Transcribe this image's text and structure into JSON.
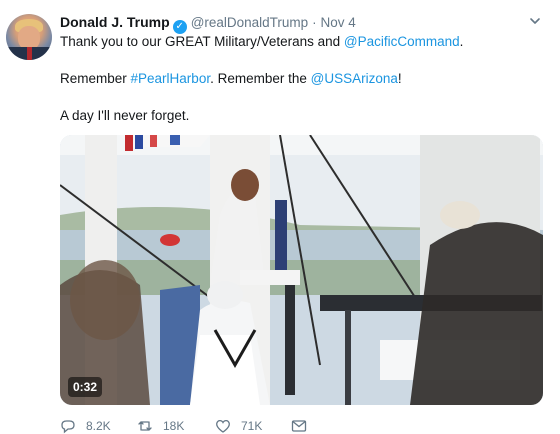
{
  "tweet": {
    "author_name": "Donald J. Trump",
    "handle": "@realDonaldTrump",
    "separator": "·",
    "time": "Nov 4",
    "line1_prefix": "Thank you to our GREAT Military/Veterans and ",
    "line1_link": "@PacificCommand",
    "line1_suffix": ".",
    "line2_prefix": "Remember ",
    "line2_hashtag": "#PearlHarbor",
    "line2_middle": ". Remember the ",
    "line2_link": "@USSArizona",
    "line2_suffix": "!",
    "line3": "A day I'll never forget.",
    "video_duration": "0:32",
    "replies": "8.2K",
    "retweets": "18K",
    "likes": "71K"
  },
  "colors": {
    "link": "#1b95e0",
    "verified": "#1da1f2",
    "secondary_text": "#657786"
  },
  "icons": [
    "verified-badge-icon",
    "chevron-down-icon",
    "reply-icon",
    "retweet-icon",
    "like-icon",
    "direct-message-icon"
  ]
}
